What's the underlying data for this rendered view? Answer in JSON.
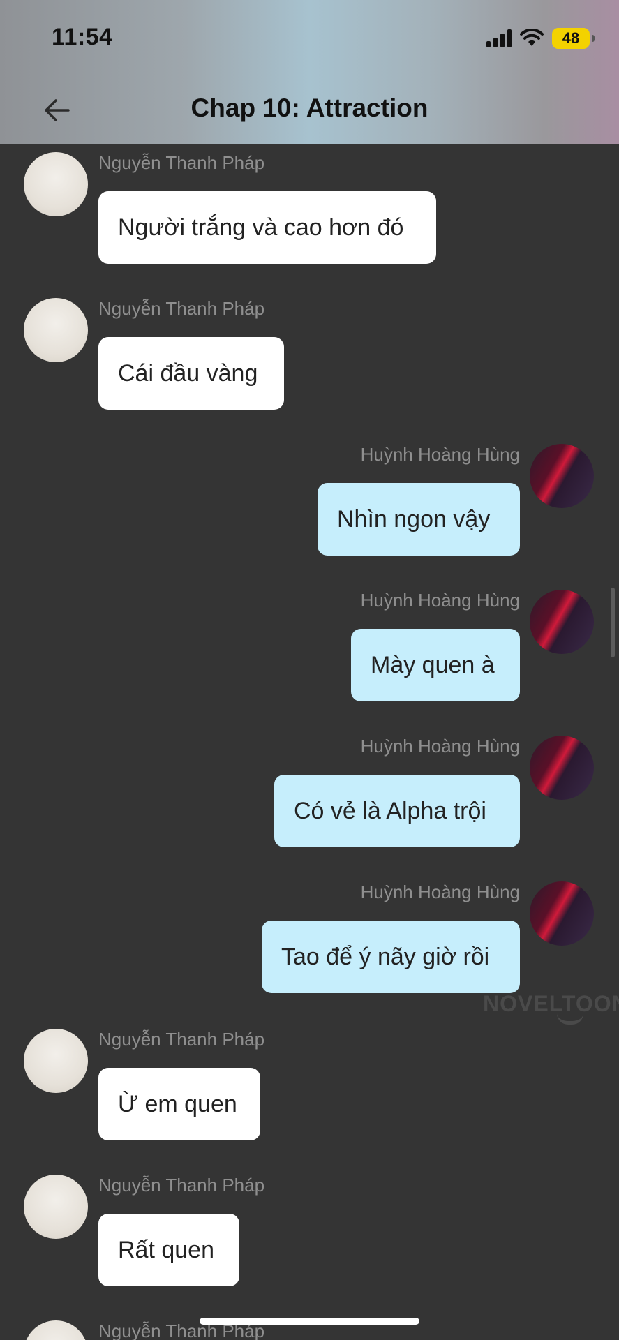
{
  "status_bar": {
    "time": "11:54",
    "battery": "48"
  },
  "header": {
    "title": "Chap 10: Attraction"
  },
  "messages": [
    {
      "sender": "Nguyễn Thanh Pháp",
      "text": "Người trắng và cao hơn đó"
    },
    {
      "sender": "Nguyễn Thanh Pháp",
      "text": "Cái đầu vàng"
    },
    {
      "sender": "Huỳnh Hoàng Hùng",
      "text": "Nhìn ngon vậy"
    },
    {
      "sender": "Huỳnh Hoàng Hùng",
      "text": "Mày quen à"
    },
    {
      "sender": "Huỳnh Hoàng Hùng",
      "text": "Có vẻ là Alpha trội"
    },
    {
      "sender": "Huỳnh Hoàng Hùng",
      "text": "Tao để ý nãy giờ rồi"
    },
    {
      "sender": "Nguyễn Thanh Pháp",
      "text": "Ừ em quen"
    },
    {
      "sender": "Nguyễn Thanh Pháp",
      "text": "Rất quen"
    },
    {
      "sender": "Nguyễn Thanh Pháp",
      "text": ""
    }
  ],
  "watermark": "NOVELTOON",
  "colors": {
    "incoming_bubble": "#ffffff",
    "outgoing_bubble": "#c6eefc",
    "background": "#343434"
  }
}
